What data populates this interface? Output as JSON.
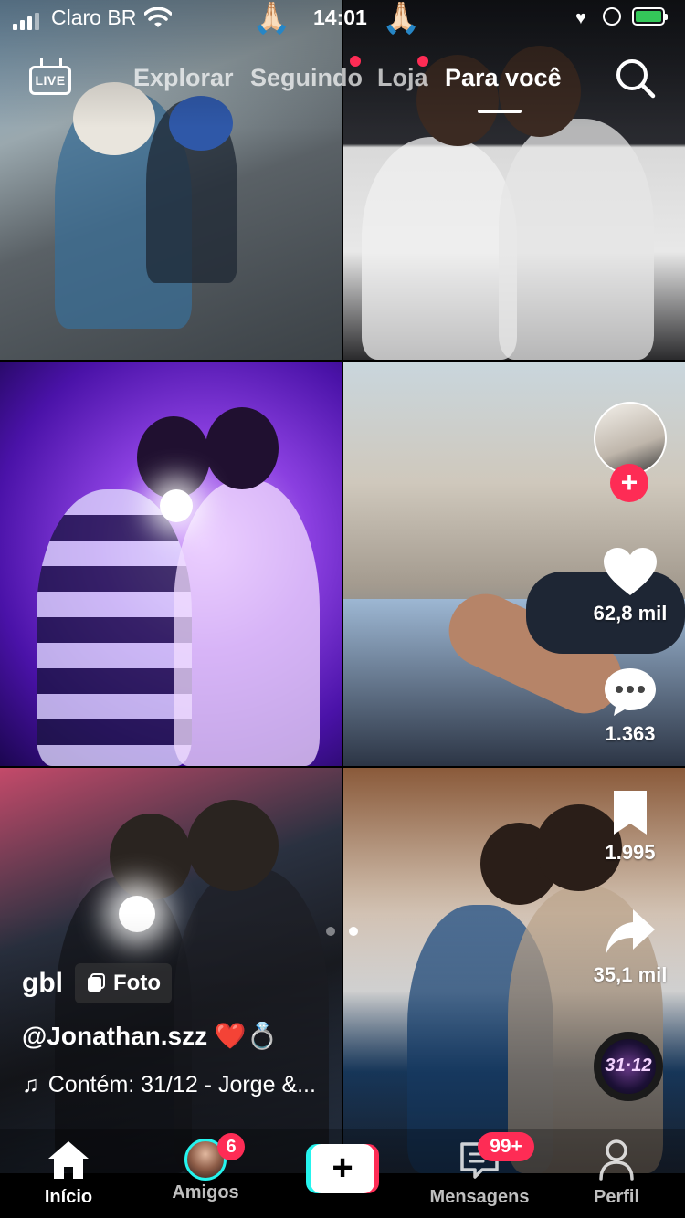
{
  "status_bar": {
    "carrier": "Claro BR",
    "time": "14:01",
    "decorations": [
      "🙏🏻",
      "🙏🏻"
    ],
    "battery_level": 1.0
  },
  "top_nav": {
    "live_label": "LIVE",
    "tabs": [
      {
        "label": "Explorar",
        "active": false,
        "dot": false
      },
      {
        "label": "Seguindo",
        "active": false,
        "dot": true
      },
      {
        "label": "Loja",
        "active": false,
        "dot": true
      },
      {
        "label": "Para você",
        "active": true,
        "dot": false
      }
    ],
    "search_icon": "search-icon"
  },
  "post": {
    "author": "gbl",
    "type_chip": "Foto",
    "caption": "@Jonathan.szz ❤️💍",
    "music": "Contém: 31/12 - Jorge &...",
    "photo_index": 2,
    "photo_count": 2
  },
  "actions": {
    "likes": "62,8 mil",
    "comments": "1.363",
    "saves": "1.995",
    "shares": "35,1 mil",
    "disc_label": "31·12",
    "follow_label": "+"
  },
  "bottom_nav": {
    "items": [
      {
        "label": "Início",
        "icon": "home-icon",
        "active": true
      },
      {
        "label": "Amigos",
        "icon": "friends-avatar",
        "badge": "6"
      },
      {
        "label": "",
        "icon": "create-icon"
      },
      {
        "label": "Mensagens",
        "icon": "inbox-icon",
        "badge": "99+"
      },
      {
        "label": "Perfil",
        "icon": "profile-icon"
      }
    ],
    "create_symbol": "+"
  },
  "colors": {
    "accent_red": "#fe2c55",
    "accent_cyan": "#25f4ee"
  }
}
